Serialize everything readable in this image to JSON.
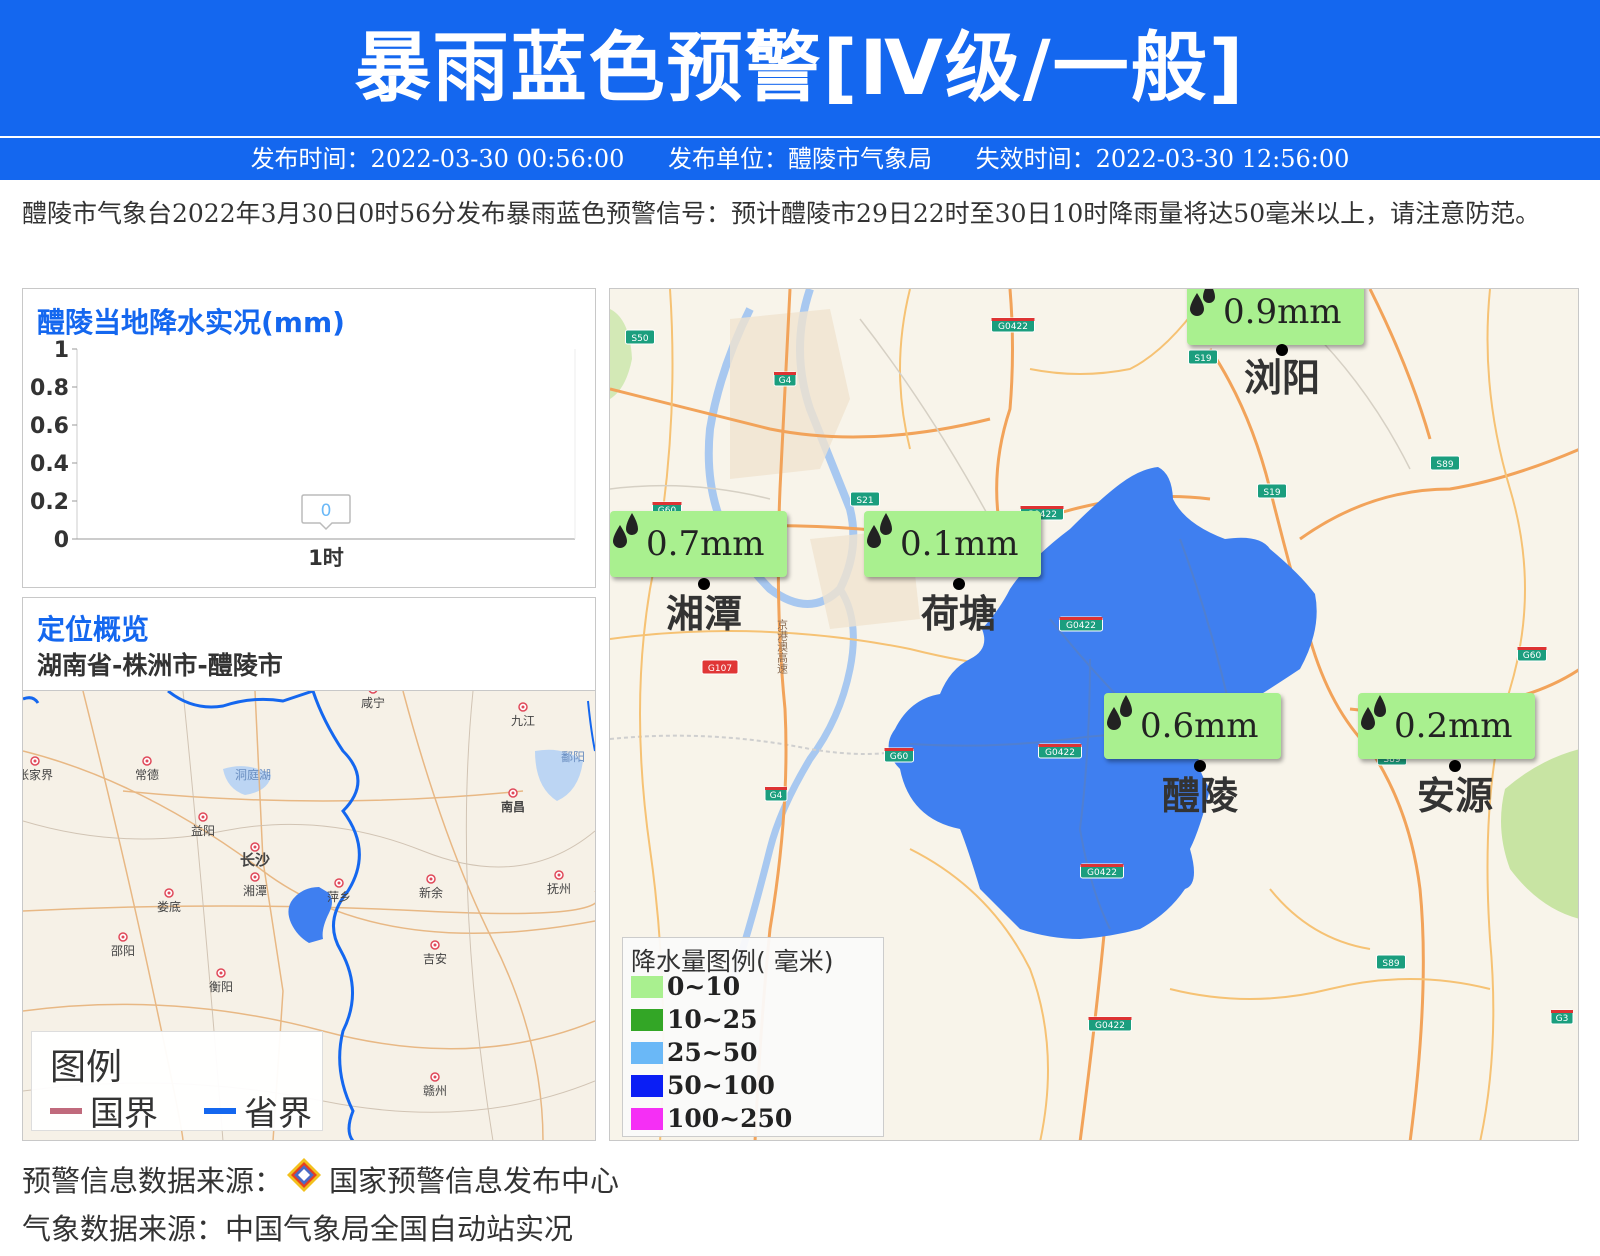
{
  "header": {
    "title": "暴雨蓝色预警[Ⅳ级/一般]",
    "publish_time": "发布时间：2022-03-30 00:56:00",
    "publish_unit": "发布单位：醴陵市气象局",
    "expire_time": "失效时间：2022-03-30 12:56:00"
  },
  "description": "醴陵市气象台2022年3月30日0时56分发布暴雨蓝色预警信号：预计醴陵市29日22时至30日10时降雨量将达50毫米以上，请注意防范。",
  "chart_panel": {
    "title": "醴陵当地降水实况(mm)"
  },
  "chart_data": {
    "type": "bar",
    "title": "醴陵当地降水实况(mm)",
    "categories": [
      "1时"
    ],
    "values": [
      0
    ],
    "data_labels": [
      "0"
    ],
    "yticks": [
      "0",
      "0.2",
      "0.4",
      "0.6",
      "0.8",
      "1"
    ],
    "ylim": [
      0,
      1
    ],
    "xlabel": "",
    "ylabel": ""
  },
  "location": {
    "title": "定位概览",
    "path": "湖南省-株洲市-醴陵市",
    "cities": [
      "咸宁",
      "九江",
      "张家界",
      "常德",
      "洞庭湖",
      "鄱阳",
      "南昌",
      "益阳",
      "长沙",
      "湘潭",
      "萍乡",
      "新余",
      "抚州",
      "娄底",
      "邵阳",
      "吉安",
      "衡阳",
      "赣州"
    ],
    "legend": {
      "title": "图例",
      "national": "国界",
      "provincial": "省界",
      "national_color": "#c06a7c",
      "provincial_color": "#1467ef"
    }
  },
  "big_map": {
    "stations": [
      {
        "name": "浏阳",
        "value": "0.9mm"
      },
      {
        "name": "湘潭",
        "value": "0.7mm"
      },
      {
        "name": "荷塘",
        "value": "0.1mm"
      },
      {
        "name": "醴陵",
        "value": "0.6mm"
      },
      {
        "name": "安源",
        "value": "0.2mm"
      }
    ],
    "road_labels": [
      "S50",
      "G0422",
      "S19",
      "G4",
      "S89",
      "G60",
      "S21",
      "G0422",
      "S19",
      "G0422",
      "G60",
      "G107",
      "G60",
      "G0422",
      "G4",
      "S89",
      "G0422",
      "G0422",
      "G3",
      "S89"
    ],
    "highway_text": "京港澳高速",
    "legend": {
      "title": "降水量图例( 毫米)",
      "items": [
        {
          "label": "0~10",
          "color": "#a9f08f"
        },
        {
          "label": "10~25",
          "color": "#33a626"
        },
        {
          "label": "25~50",
          "color": "#6ab8f7"
        },
        {
          "label": "50~100",
          "color": "#0a1ef5"
        },
        {
          "label": "100~250",
          "color": "#f52ff5"
        }
      ]
    },
    "region_color": "#3f7ff0"
  },
  "footer": {
    "warning_source": "预警信息数据来源：",
    "warning_source_name": "国家预警信息发布中心",
    "weather_source": "气象数据来源：中国气象局全国自动站实况"
  }
}
